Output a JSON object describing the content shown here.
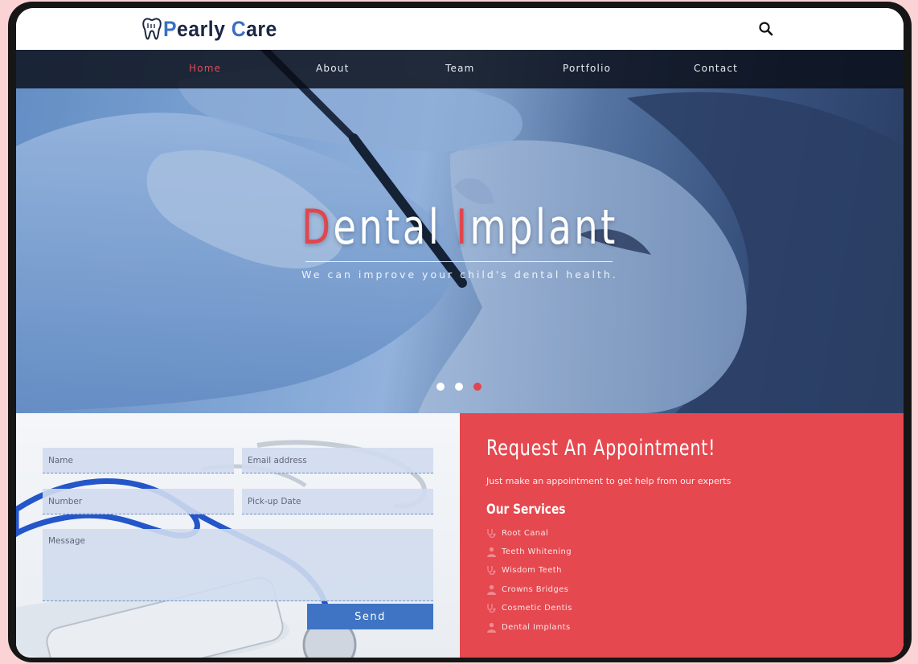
{
  "brand": {
    "logo_first": "P",
    "logo_rest_1": "early ",
    "logo_accent_2": "C",
    "logo_rest_2": "are"
  },
  "header": {
    "search_icon": "search-icon"
  },
  "nav": {
    "items": [
      {
        "label": "Home",
        "active": true
      },
      {
        "label": "About",
        "active": false
      },
      {
        "label": "Team",
        "active": false
      },
      {
        "label": "Portfolio",
        "active": false
      },
      {
        "label": "Contact",
        "active": false
      }
    ]
  },
  "hero": {
    "title_letter_1": "D",
    "title_rest_1": "ental ",
    "title_letter_2": "I",
    "title_rest_2": "mplant",
    "subtitle": "We can improve your child's dental health.",
    "slides_count": 3,
    "active_slide": 3
  },
  "form": {
    "name_placeholder": "Name",
    "email_placeholder": "Email address",
    "number_placeholder": "Number",
    "date_placeholder": "Pick-up Date",
    "message_placeholder": "Message",
    "send_label": "Send"
  },
  "appointment": {
    "title": "Request An Appointment!",
    "subtitle": "Just make an appointment to get help from our experts",
    "services_title": "Our Services",
    "services": [
      {
        "label": "Root Canal",
        "icon": "stethoscope-icon"
      },
      {
        "label": "Teeth Whitening",
        "icon": "user-md-icon"
      },
      {
        "label": "Wisdom Teeth",
        "icon": "stethoscope-icon"
      },
      {
        "label": "Crowns Bridges",
        "icon": "user-md-icon"
      },
      {
        "label": "Cosmetic Dentis",
        "icon": "stethoscope-icon"
      },
      {
        "label": "Dental Implants",
        "icon": "user-md-icon"
      }
    ]
  },
  "colors": {
    "accent_red": "#e5484f",
    "brand_navy": "#1c2744",
    "brand_blue": "#3a6fc3",
    "nav_bg": "#0b101a",
    "page_bg": "#fbd3d5"
  }
}
